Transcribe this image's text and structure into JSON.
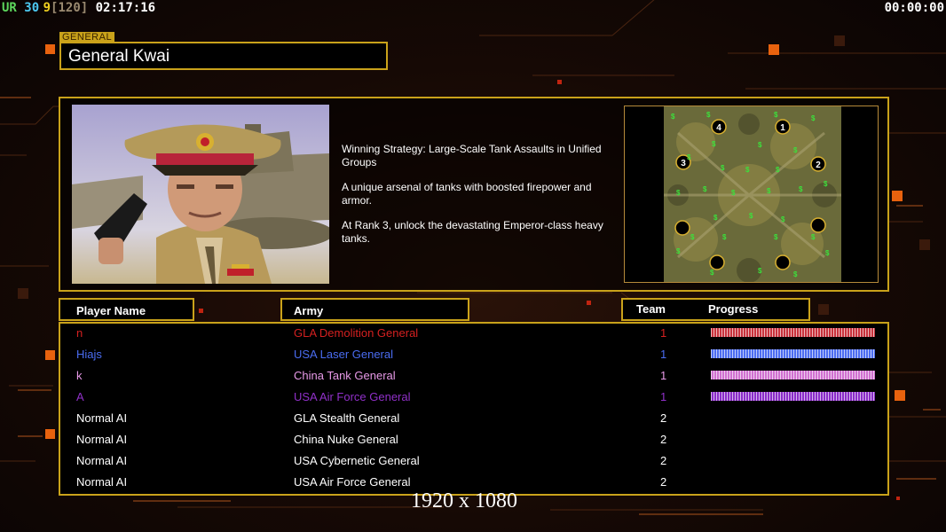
{
  "hud": {
    "prefix": "UR",
    "fps": "30",
    "count": "9",
    "bracket": "[120]",
    "clock": "02:17:16",
    "timer": "00:00:00"
  },
  "general": {
    "tag": "GENERAL",
    "name": "General Kwai",
    "strategy": [
      "Winning Strategy: Large-Scale Tank Assaults in Unified Groups",
      "A unique arsenal of tanks with boosted firepower and armor.",
      "At Rank 3, unlock the devastating Emperor-class heavy tanks."
    ]
  },
  "columns": {
    "player": "Player Name",
    "army": "Army",
    "team": "Team",
    "progress": "Progress"
  },
  "players": [
    {
      "name": "n",
      "army": "GLA Demolition General",
      "team": "1",
      "color": "#d42020",
      "progress": 1.0,
      "bar": "#c8323c"
    },
    {
      "name": "Hiajs",
      "army": "USA Laser General",
      "team": "1",
      "color": "#4a6cf0",
      "progress": 1.0,
      "bar": "#4c6cf0"
    },
    {
      "name": "k",
      "army": "China Tank General",
      "team": "1",
      "color": "#e89ae8",
      "progress": 1.0,
      "bar": "#d070d0"
    },
    {
      "name": "A",
      "army": "USA Air Force General",
      "team": "1",
      "color": "#9030c8",
      "progress": 1.0,
      "bar": "#8a2cc8"
    },
    {
      "name": "Normal AI",
      "army": "GLA Stealth General",
      "team": "2",
      "color": "#ffffff"
    },
    {
      "name": "Normal AI",
      "army": "China Nuke General",
      "team": "2",
      "color": "#ffffff"
    },
    {
      "name": "Normal AI",
      "army": "USA Cybernetic General",
      "team": "2",
      "color": "#ffffff"
    },
    {
      "name": "Normal AI",
      "army": "USA Air Force General",
      "team": "2",
      "color": "#ffffff"
    }
  ],
  "map": {
    "start_labels": [
      "4",
      "1",
      "3",
      "2"
    ],
    "supply_symbol": "$"
  },
  "resolution": "1920 x 1080",
  "colors": {
    "accent": "#c9a21a",
    "hud_green": "#5cd65c",
    "hud_cyan": "#4cc8f0",
    "hud_yellow": "#f0d020",
    "hud_gray": "#9a8a70"
  }
}
